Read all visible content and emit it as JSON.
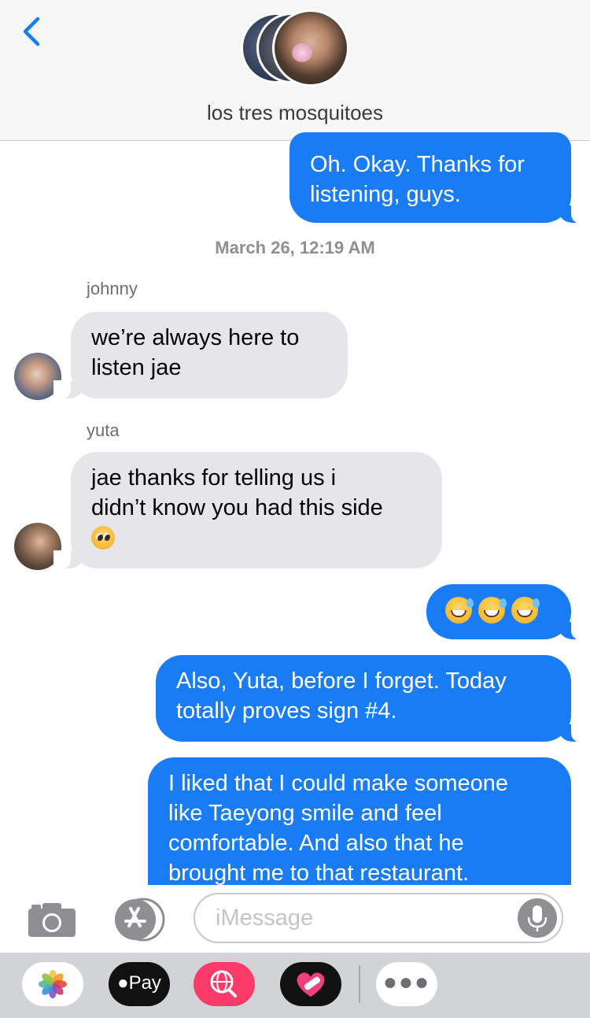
{
  "header": {
    "title": "los tres mosquitoes"
  },
  "messages": {
    "m1": {
      "lines": [
        "Oh. Okay. Thanks for",
        "listening, guys."
      ]
    },
    "timestamp": "March 26, 12:19 AM",
    "johnny": {
      "sender": "johnny",
      "lines": [
        "we’re always here to",
        "listen jae"
      ]
    },
    "yuta": {
      "sender": "yuta",
      "lines": [
        "jae thanks for telling us i",
        "didn’t know you had this side"
      ]
    },
    "m4": {
      "emoji": "grinning-sweat-emoji x3"
    },
    "m5": {
      "lines": [
        "Also, Yuta, before I forget. Today",
        "totally proves sign #4."
      ]
    },
    "m6": {
      "lines": [
        "I liked that I could make someone",
        "like Taeyong smile and feel",
        "comfortable. And also that he",
        "brought me to that restaurant."
      ]
    }
  },
  "input": {
    "placeholder": "iMessage"
  },
  "drawer": {
    "applepay_label": "Pay"
  },
  "colors": {
    "outgoing_bubble": "#1a7cf5",
    "incoming_bubble": "#e5e5ea",
    "ios_blue": "#157efb",
    "search_app": "#fa3a68"
  }
}
